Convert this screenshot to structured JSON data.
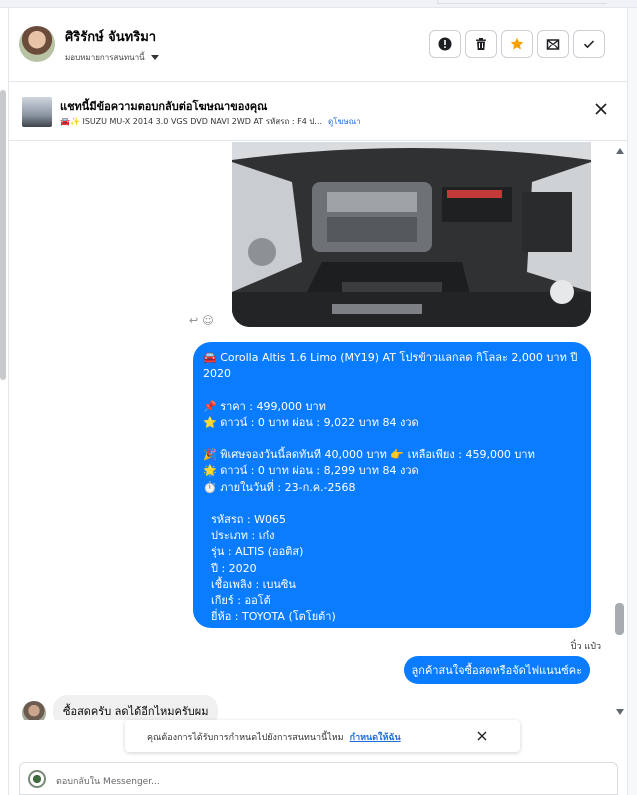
{
  "header": {
    "contact_name": "ศิริรักษ์ จันทริมา",
    "assign_label": "มอบหมายการสนทนานี้",
    "action_icons": [
      "alert-icon",
      "trash-icon",
      "star-icon",
      "mark-unread-icon",
      "check-icon"
    ]
  },
  "ad_banner": {
    "title": "แชทนี้มีข้อความตอบกลับต่อโฆษณาของคุณ",
    "subtitle": "ISUZU MU-X 2014 3.0 VGS DVD NAVI 2WD AT รหัสรถ : F4 ป...",
    "subtitle_prefix": "🚘✨",
    "view_ad_link": "ดูโฆษณา"
  },
  "messages": {
    "page_message_lines": [
      "🚘 Corolla Altis 1.6 Limo (MY19) AT โปรข้าวแลกลด กิโลละ 2,000 บาท ปี",
      "2020",
      "",
      "📌 ราคา : 499,000 บาท",
      "⭐ ดาวน์ : 0 บาท ผ่อน : 9,022 บาท 84 งวด",
      "",
      "🎉 พิเศษจองวันนี้ลดทันที 40,000 บาท 👉 เหลือเพียง : 459,000 บาท",
      "🌟 ดาวน์ : 0 บาท ผ่อน : 8,299 บาท 84 งวด",
      "⏱️ ภายในวันที่ : 23-ก.ค.-2568",
      "",
      "   รหัสรถ : W065",
      "  ประเภท : เก๋ง",
      "  รุ่น : ALTIS (ออติส)",
      "  ปี : 2020",
      "  เชื้อเพลิง : เบนซิน",
      "  เกียร์ : ออโต้",
      "  ยี่ห้อ : TOYOTA (โตโยต้า)"
    ],
    "sender_name": "ปิ๋ว แป๋ว",
    "page_question": "ลูกค้าสนใจซื้อสดหรือจัดไฟแนนซ์คะ",
    "customer_reply": "ซื้อสดครับ ลดได้อีกไหมครับผม"
  },
  "prompt": {
    "text": "คุณต้องการได้รับการกำหนดไปยังการสนทนานี้ไหม",
    "link": "กำหนดให้ฉัน"
  },
  "composer": {
    "placeholder": "ตอบกลับใน Messenger..."
  },
  "colors": {
    "bubble_blue": "#0a7cff",
    "link_blue": "#216fdb",
    "star_orange": "#f7a100"
  }
}
